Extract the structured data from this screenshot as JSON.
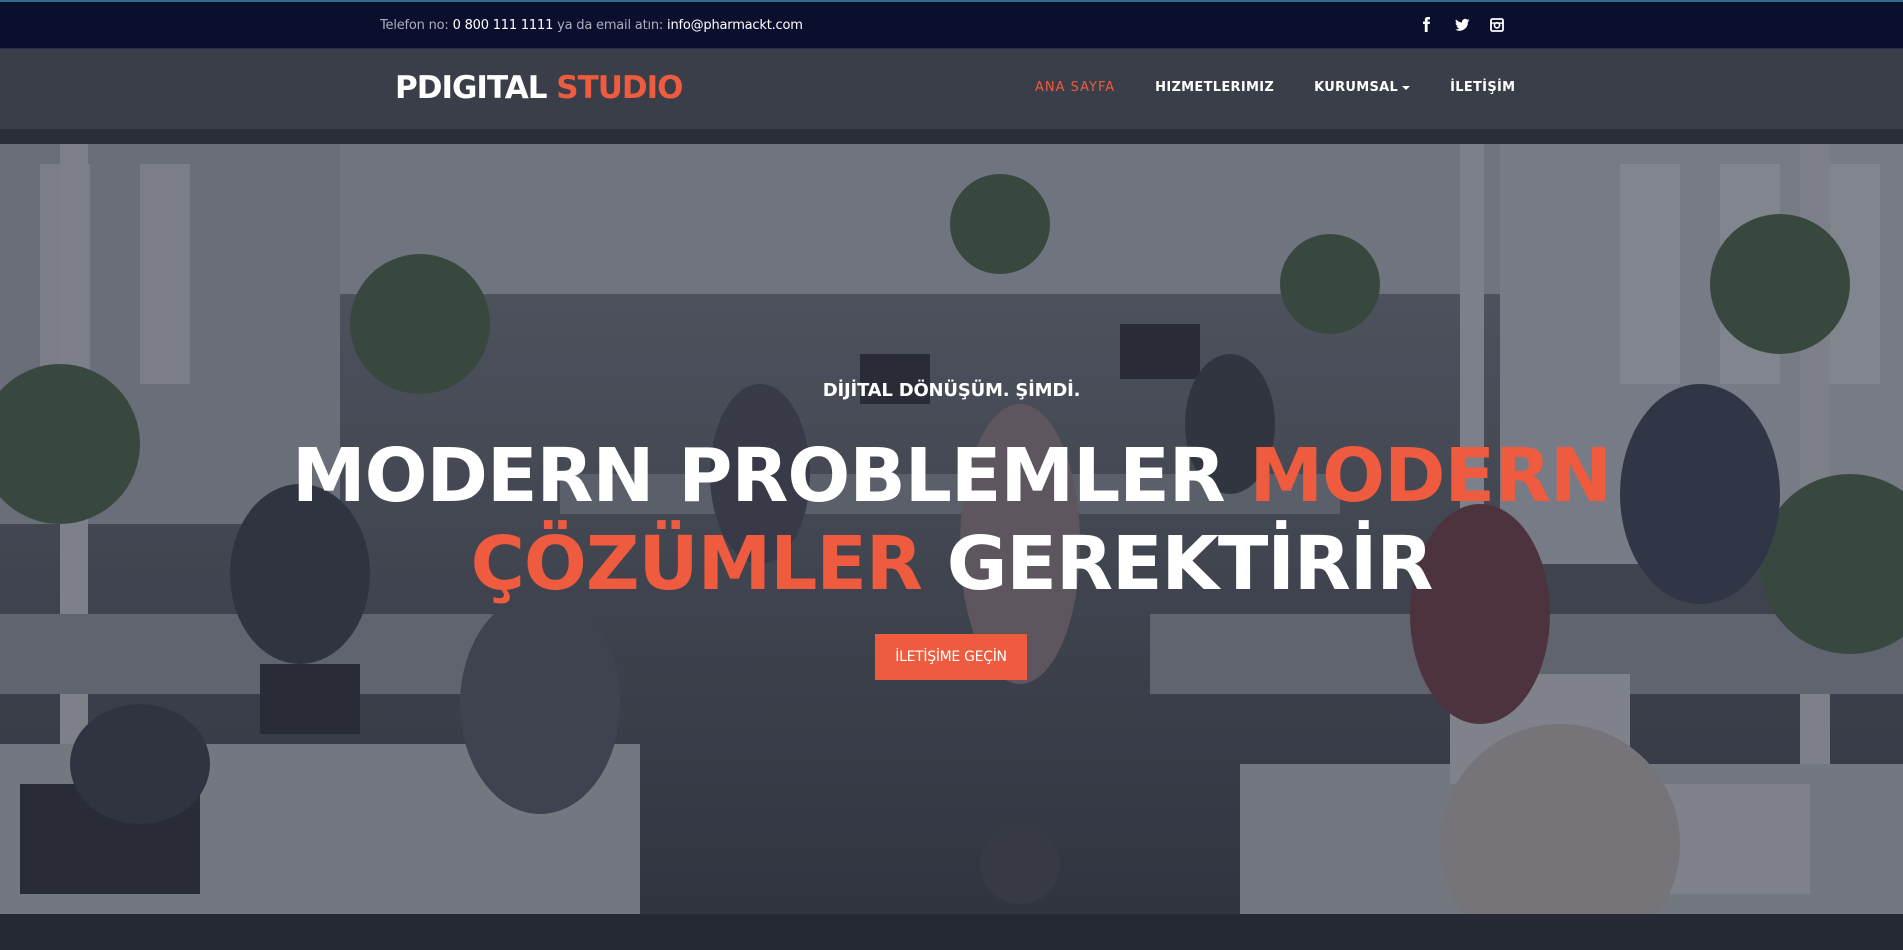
{
  "topbar": {
    "phone_label": "Telefon no:",
    "phone": "0 800 111 1111",
    "middle_text": "ya da email atın:",
    "email": "info@pharmackt.com",
    "socials": [
      "facebook-icon",
      "twitter-icon",
      "instagram-icon"
    ]
  },
  "brand": {
    "part1": "PDIGITAL",
    "part2": "STUDIO"
  },
  "nav": {
    "items": [
      {
        "label": "ANA SAYFA",
        "active": true
      },
      {
        "label": "HIZMETLERIMIZ",
        "active": false
      },
      {
        "label": "KURUMSAL",
        "active": false,
        "dropdown": true
      },
      {
        "label": "İLETİŞİM",
        "active": false
      }
    ]
  },
  "hero": {
    "eyebrow": "DİJİTAL DÖNÜŞÜM. ŞİMDİ.",
    "line1_white": "MODERN PROBLEMLER",
    "line1_accent": "MODERN",
    "line2_accent": "ÇÖZÜMLER",
    "line2_white": "GEREKTİRİR",
    "cta": "İLETİŞİME GEÇİN"
  },
  "colors": {
    "accent": "#ef5b3f",
    "topbar_bg": "#0b0f2e",
    "navbar_bg": "#3a3e48"
  }
}
